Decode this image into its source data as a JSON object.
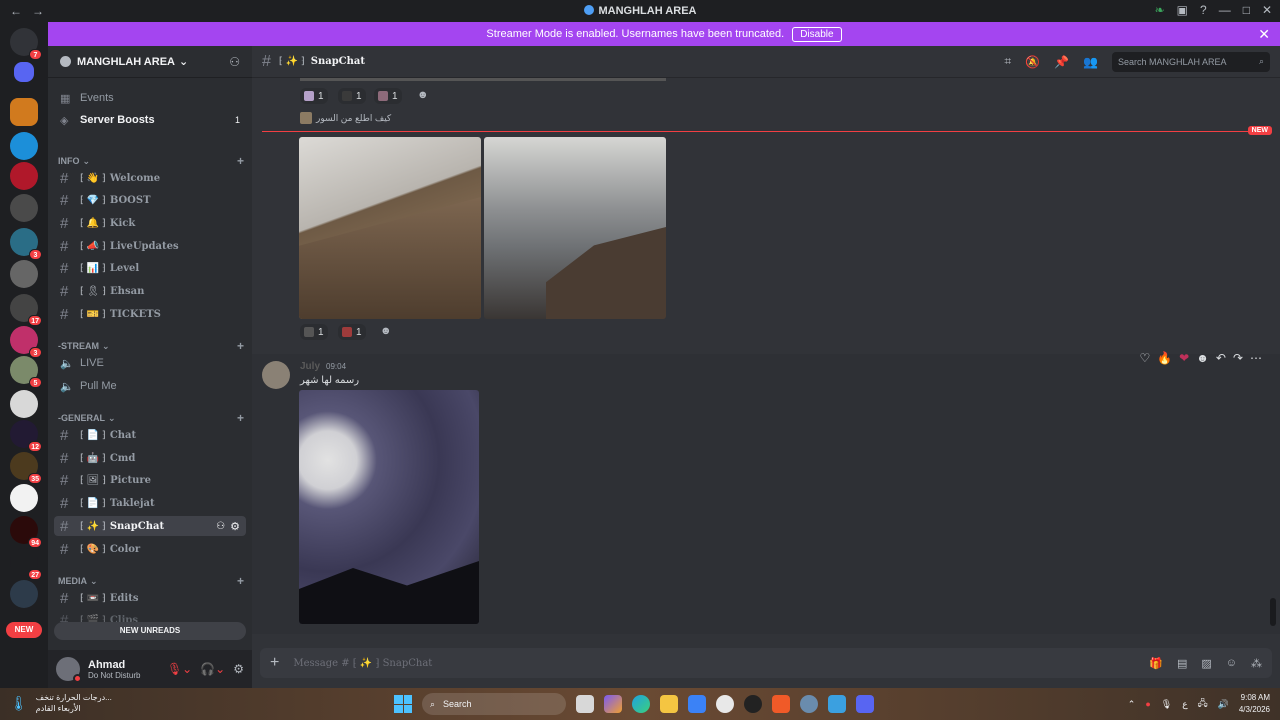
{
  "window": {
    "title": "MANGHLAH AREA"
  },
  "banner": {
    "text": "Streamer Mode is enabled. Usernames have been truncated.",
    "disable_label": "Disable"
  },
  "servers": {
    "badges": [
      "7",
      "3",
      "17",
      "3",
      "5",
      "12",
      "35",
      "94",
      "27"
    ],
    "new_label": "NEW"
  },
  "sidebar": {
    "guild_name": "MANGHLAH AREA",
    "top_items": [
      {
        "label": "Events"
      },
      {
        "label": "Server Boosts",
        "count": "1"
      }
    ],
    "categories": {
      "info": "INFO",
      "stream": "STREAM",
      "general": "GENERAL",
      "media": "MEDIA"
    },
    "info_channels": [
      "Welcome",
      "BOOST",
      "Kick",
      "LiveUpdates",
      "Level",
      "Ehsan",
      "TICKETS"
    ],
    "stream_channels": [
      "LIVE",
      "Pull Me"
    ],
    "general_channels": [
      "Chat",
      "Cmd",
      "Picture",
      "Taklejat",
      "SnapChat",
      "Color"
    ],
    "media_channels": [
      "Edits",
      "Clips"
    ],
    "new_unreads": "NEW UNREADS"
  },
  "user": {
    "name": "Ahmad",
    "status": "Do Not Disturb"
  },
  "header": {
    "channel": "SnapChat",
    "search_placeholder": "Search MANGHLAH AREA"
  },
  "messages": {
    "top_reactions": [
      "1",
      "1",
      "1"
    ],
    "reply_preview": "كيف اطلع من السور",
    "new_tag": "NEW",
    "mid_reactions": [
      "1",
      "1"
    ],
    "post": {
      "author": "July",
      "time": "09:04",
      "text": "رسمه لها شهر"
    }
  },
  "composer": {
    "placeholder": "Message # ⁅ ✨ ⁆ SnapChat"
  },
  "taskbar": {
    "weather_line1": "درجات الحرارة تنخف...",
    "weather_line2": "الأربعاء القادم",
    "search": "Search",
    "time": "9:08 AM",
    "date": "4/3/2026",
    "lang": "ع"
  },
  "colors": {
    "banner": "#a445f0",
    "accent": "#f23f43",
    "sidebar": "#2b2d31",
    "main": "#313338"
  }
}
